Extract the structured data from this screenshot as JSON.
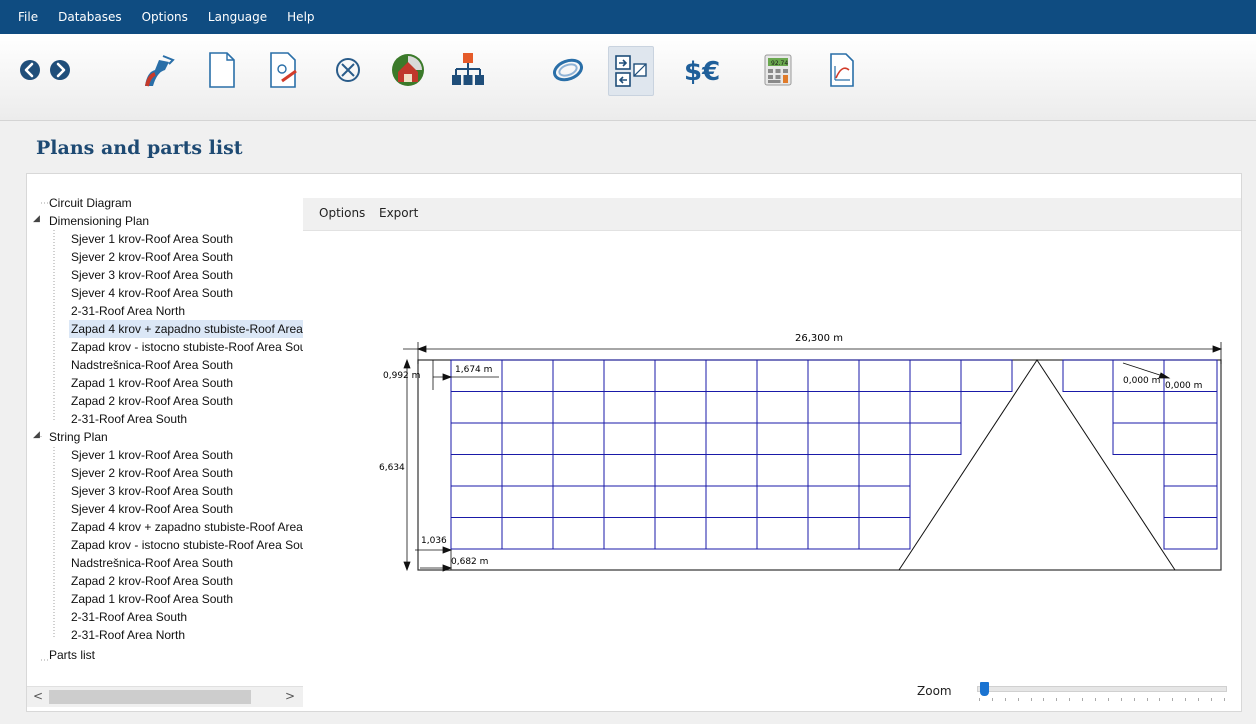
{
  "menu": [
    "File",
    "Databases",
    "Options",
    "Language",
    "Help"
  ],
  "toolbar": {
    "icons": [
      "back-arrow-icon",
      "forward-arrow-icon",
      "project-data-icon",
      "new-document-icon",
      "edit-document-icon",
      "cancel-circle-icon",
      "3d-house-icon",
      "circuit-tree-icon",
      "cable-ring-icon",
      "plans-parts-icon",
      "currency-icon",
      "calculator-icon",
      "report-graph-icon"
    ],
    "calc_display": "92.74"
  },
  "page": {
    "title": "Plans and parts list"
  },
  "tree": {
    "items": [
      {
        "label": "Circuit Diagram",
        "level": 0
      },
      {
        "label": "Dimensioning Plan",
        "level": 0,
        "expanded": true
      },
      {
        "label": "Sjever 1 krov-Roof Area South",
        "level": 1
      },
      {
        "label": "Sjever 2 krov-Roof Area South",
        "level": 1
      },
      {
        "label": "Sjever 3 krov-Roof Area South",
        "level": 1
      },
      {
        "label": "Sjever 4 krov-Roof Area South",
        "level": 1
      },
      {
        "label": "2-31-Roof Area North",
        "level": 1
      },
      {
        "label": "Zapad 4 krov + zapadno stubiste-Roof Area",
        "level": 1,
        "selected": true
      },
      {
        "label": "Zapad krov - istocno stubiste-Roof Area Sou",
        "level": 1
      },
      {
        "label": "Nadstrešnica-Roof Area South",
        "level": 1
      },
      {
        "label": "Zapad 1 krov-Roof Area South",
        "level": 1
      },
      {
        "label": "Zapad 2 krov-Roof Area South",
        "level": 1
      },
      {
        "label": "2-31-Roof Area South",
        "level": 1
      },
      {
        "label": "String Plan",
        "level": 0,
        "expanded": true
      },
      {
        "label": "Sjever 1 krov-Roof Area South",
        "level": 1
      },
      {
        "label": "Sjever 2 krov-Roof Area South",
        "level": 1
      },
      {
        "label": "Sjever 3 krov-Roof Area South",
        "level": 1
      },
      {
        "label": "Sjever 4 krov-Roof Area South",
        "level": 1
      },
      {
        "label": "Zapad 4 krov + zapadno stubiste-Roof Area",
        "level": 1
      },
      {
        "label": "Zapad krov - istocno stubiste-Roof Area Sou",
        "level": 1
      },
      {
        "label": "Nadstrešnica-Roof Area South",
        "level": 1
      },
      {
        "label": "Zapad 2 krov-Roof Area South",
        "level": 1
      },
      {
        "label": "Zapad 1 krov-Roof Area South",
        "level": 1
      },
      {
        "label": "2-31-Roof Area South",
        "level": 1
      },
      {
        "label": "2-31-Roof Area North",
        "level": 1
      },
      {
        "label": "Parts list",
        "level": 0
      }
    ],
    "scroll_left": "<",
    "scroll_right": ">"
  },
  "plan_menu": {
    "options": "Options",
    "export": "Export"
  },
  "drawing": {
    "dim_width": "26,300 m",
    "dim_height": "6,634",
    "dim_top_margin": "0,992 m",
    "dim_module_width": "1,674 m",
    "dim_bottom_margin": "1,036",
    "dim_left_margin": "0,682 m",
    "dim_right_a": "0,000 m",
    "dim_right_b": "0,000 m"
  },
  "zoom": {
    "label": "Zoom",
    "value": 0.02
  },
  "colors": {
    "menubar": "#0f4c81",
    "title": "#1e4a73",
    "module_stroke": "#1a1aa8",
    "selection": "#dbe7f6"
  }
}
